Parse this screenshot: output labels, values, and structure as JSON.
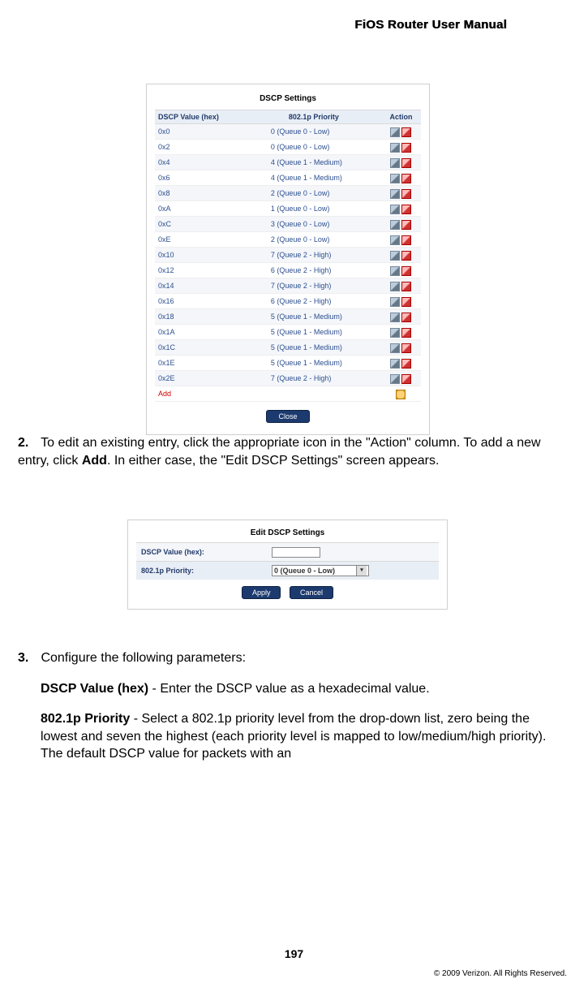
{
  "header": {
    "title": "FiOS Router User Manual"
  },
  "dscp_panel": {
    "title": "DSCP Settings",
    "headers": {
      "value": "DSCP Value (hex)",
      "priority": "802.1p Priority",
      "action": "Action"
    },
    "rows": [
      {
        "value": "0x0",
        "priority": "0 (Queue 0 - Low)"
      },
      {
        "value": "0x2",
        "priority": "0 (Queue 0 - Low)"
      },
      {
        "value": "0x4",
        "priority": "4 (Queue 1 - Medium)"
      },
      {
        "value": "0x6",
        "priority": "4 (Queue 1 - Medium)"
      },
      {
        "value": "0x8",
        "priority": "2 (Queue 0 - Low)"
      },
      {
        "value": "0xA",
        "priority": "1 (Queue 0 - Low)"
      },
      {
        "value": "0xC",
        "priority": "3 (Queue 0 - Low)"
      },
      {
        "value": "0xE",
        "priority": "2 (Queue 0 - Low)"
      },
      {
        "value": "0x10",
        "priority": "7 (Queue 2 - High)"
      },
      {
        "value": "0x12",
        "priority": "6 (Queue 2 - High)"
      },
      {
        "value": "0x14",
        "priority": "7 (Queue 2 - High)"
      },
      {
        "value": "0x16",
        "priority": "6 (Queue 2 - High)"
      },
      {
        "value": "0x18",
        "priority": "5 (Queue 1 - Medium)"
      },
      {
        "value": "0x1A",
        "priority": "5 (Queue 1 - Medium)"
      },
      {
        "value": "0x1C",
        "priority": "5 (Queue 1 - Medium)"
      },
      {
        "value": "0x1E",
        "priority": "5 (Queue 1 - Medium)"
      },
      {
        "value": "0x2E",
        "priority": "7 (Queue 2 - High)"
      }
    ],
    "add_label": "Add",
    "close_label": "Close"
  },
  "step2": {
    "number": "2.",
    "text_a": " To edit an existing entry, click the appropriate icon in the \"Action\" column. To add a new entry, click ",
    "bold": "Add",
    "text_b": ". In either case, the \"Edit DSCP Settings\" screen appears."
  },
  "edit_panel": {
    "title": "Edit DSCP Settings",
    "label_value": "DSCP Value (hex):",
    "label_priority": "802.1p Priority:",
    "select_value": "0 (Queue 0 - Low)",
    "apply": "Apply",
    "cancel": "Cancel"
  },
  "step3": {
    "number": "3.",
    "intro": "Configure the following parameters:",
    "p1_label": "DSCP Value (hex)",
    "p1_text": " - Enter the DSCP value as a hexadecimal value.",
    "p2_label": "802.1p Priority",
    "p2_text": " - Select a 802.1p priority level from the drop-down list, zero being the lowest and seven the highest (each priority level is mapped to low/medium/high priority). The default DSCP value for packets with an"
  },
  "footer": {
    "page": "197",
    "copyright": "© 2009 Verizon. All Rights Reserved."
  }
}
